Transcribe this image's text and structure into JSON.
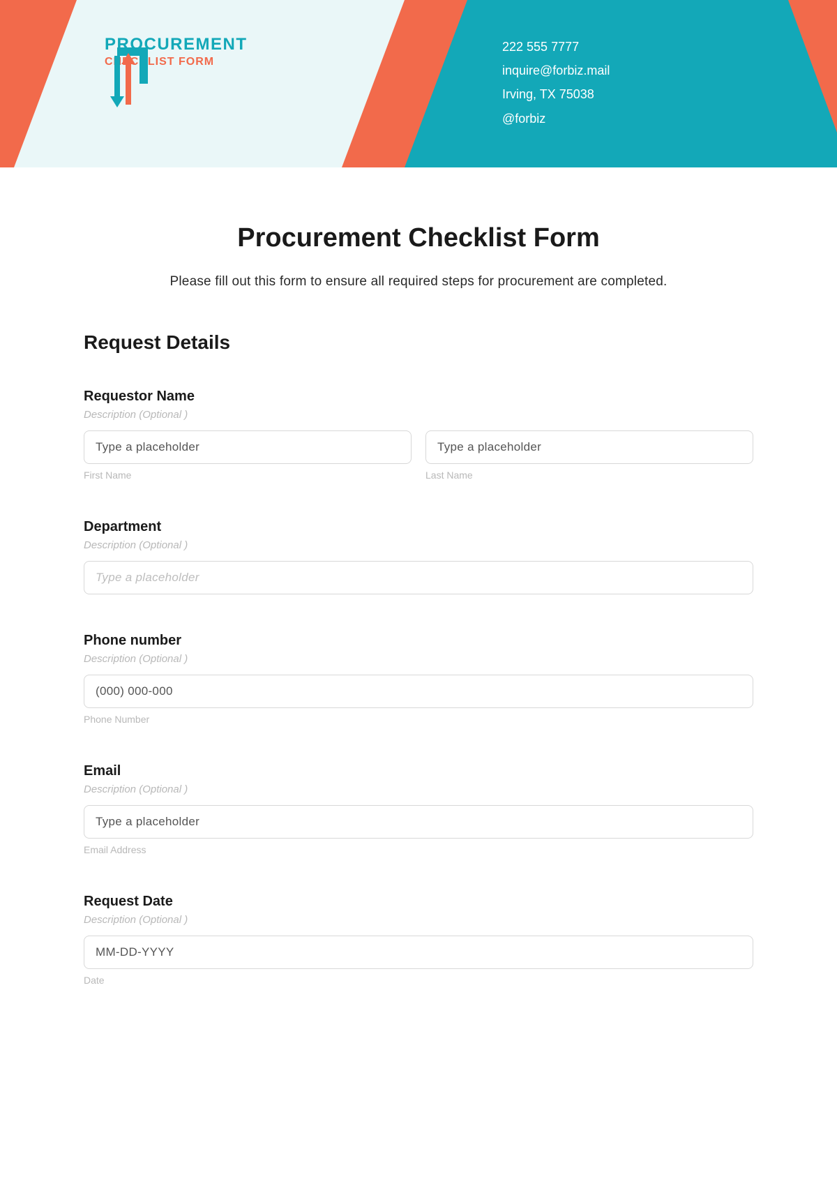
{
  "header": {
    "logo_title": "PROCUREMENT",
    "logo_sub": "CHECKLIST FORM",
    "contact": {
      "phone": "222 555 7777",
      "email": "inquire@forbiz.mail",
      "address": "Irving, TX 75038",
      "handle": "@forbiz"
    }
  },
  "main": {
    "title": "Procurement Checklist Form",
    "subtitle": "Please fill out this form to ensure all required steps for procurement are completed.",
    "section": "Request Details",
    "fields": {
      "requestor": {
        "label": "Requestor Name",
        "desc": "Description (Optional )",
        "first_ph": "Type a placeholder",
        "last_ph": "Type a placeholder",
        "first_sub": "First Name",
        "last_sub": "Last Name"
      },
      "department": {
        "label": "Department",
        "desc": "Description (Optional )",
        "ph": "Type a placeholder"
      },
      "phone": {
        "label": "Phone number",
        "desc": "Description (Optional )",
        "ph": "(000) 000-000",
        "sub": "Phone Number"
      },
      "email": {
        "label": "Email",
        "desc": "Description (Optional )",
        "ph": "Type a placeholder",
        "sub": "Email Address"
      },
      "date": {
        "label": "Request Date",
        "desc": "Description (Optional )",
        "ph": "MM-DD-YYYY",
        "sub": "Date"
      }
    }
  }
}
